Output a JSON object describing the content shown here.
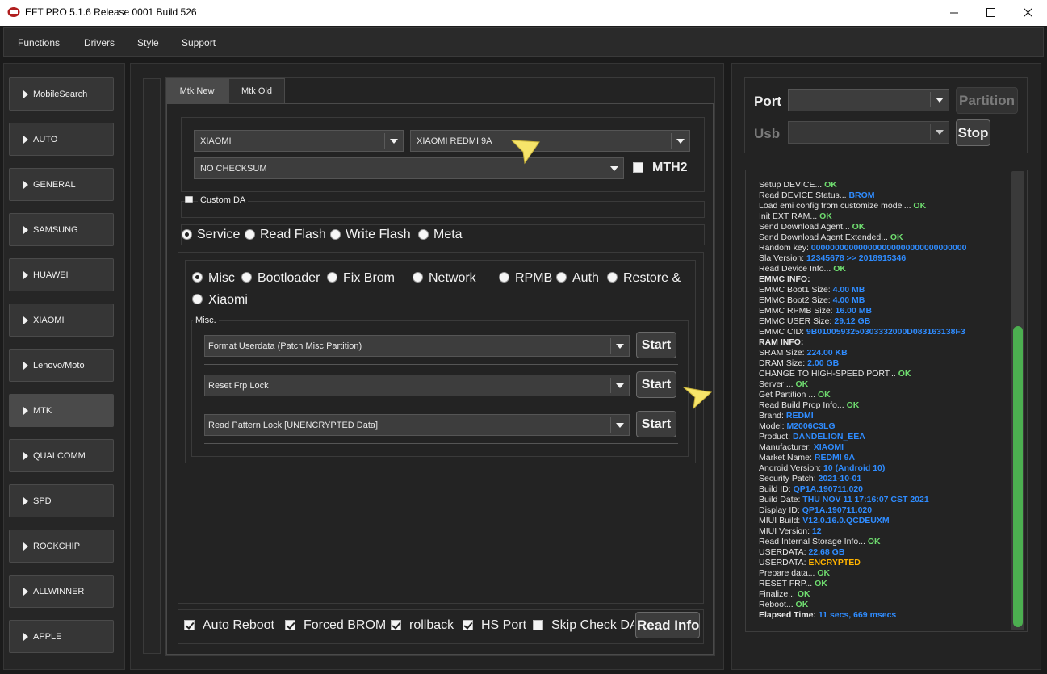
{
  "window": {
    "title": "EFT PRO 5.1.6 Release 0001 Build 526"
  },
  "menu": [
    "Functions",
    "Drivers",
    "Style",
    "Support"
  ],
  "sidebar": [
    {
      "label": "MobileSearch",
      "active": false
    },
    {
      "label": "AUTO",
      "active": false
    },
    {
      "label": "GENERAL",
      "active": false
    },
    {
      "label": "SAMSUNG",
      "active": false
    },
    {
      "label": "HUAWEI",
      "active": false
    },
    {
      "label": "XIAOMI",
      "active": false
    },
    {
      "label": "Lenovo/Moto",
      "active": false
    },
    {
      "label": "MTK",
      "active": true
    },
    {
      "label": "QUALCOMM",
      "active": false
    },
    {
      "label": "SPD",
      "active": false
    },
    {
      "label": "ROCKCHIP",
      "active": false
    },
    {
      "label": "ALLWINNER",
      "active": false
    },
    {
      "label": "APPLE",
      "active": false
    }
  ],
  "tabs": {
    "active": "Mtk New",
    "inactive": "Mtk Old"
  },
  "device": {
    "brand": "XIAOMI",
    "model": "XIAOMI REDMI 9A",
    "checksum": "NO CHECKSUM",
    "mth2_label": "MTH2",
    "custom_da_label": "Custom DA"
  },
  "modes": [
    {
      "label": "Service",
      "checked": true
    },
    {
      "label": "Read Flash",
      "checked": false
    },
    {
      "label": "Write Flash",
      "checked": false
    },
    {
      "label": "Meta",
      "checked": false
    }
  ],
  "subtabs": [
    {
      "label": "Misc",
      "checked": true
    },
    {
      "label": "Bootloader",
      "checked": false
    },
    {
      "label": "Fix Brom",
      "checked": false
    },
    {
      "label": "Network",
      "checked": false
    },
    {
      "label": "RPMB",
      "checked": false
    },
    {
      "label": "Auth",
      "checked": false
    },
    {
      "label": "Restore &",
      "checked": false
    },
    {
      "label": "Xiaomi",
      "checked": false
    }
  ],
  "misc": {
    "group_label": "Misc.",
    "start_label": "Start",
    "operations": [
      "Format Userdata (Patch Misc Partition)",
      "Reset Frp Lock",
      "Read Pattern Lock [UNENCRYPTED Data]"
    ]
  },
  "options": [
    {
      "label": "Auto Reboot",
      "checked": true
    },
    {
      "label": "Forced BROM",
      "checked": true
    },
    {
      "label": "rollback",
      "checked": true
    },
    {
      "label": "HS Port",
      "checked": true
    },
    {
      "label": "Skip Check DA",
      "checked": false
    }
  ],
  "read_info_label": "Read Info",
  "port": {
    "port_label": "Port",
    "usb_label": "Usb",
    "partition_label": "Partition",
    "stop_label": "Stop"
  },
  "colors": {
    "ok": "#6fdc6f",
    "value": "#2f8cff",
    "warn": "#ffb300"
  },
  "log": [
    {
      "text": "Setup DEVICE... ",
      "value": "OK",
      "color": "ok"
    },
    {
      "text": "Read DEVICE Status... ",
      "value": "BROM",
      "color": "value"
    },
    {
      "text": "Load emi config from customize model... ",
      "value": "OK",
      "color": "ok"
    },
    {
      "text": "Init EXT RAM... ",
      "value": "OK",
      "color": "ok"
    },
    {
      "text": "Send Download Agent... ",
      "value": "OK",
      "color": "ok"
    },
    {
      "text": "Send Download Agent Extended... ",
      "value": "OK",
      "color": "ok"
    },
    {
      "text": "Random key:  ",
      "value": "000000000000000000000000000000000",
      "color": "value"
    },
    {
      "text": "Sla Version:  ",
      "value": "12345678  >> 2018915346",
      "color": "value"
    },
    {
      "text": "Read Device Info... ",
      "value": "OK",
      "color": "ok"
    },
    {
      "text": " EMMC INFO:",
      "value": "",
      "color": "ok",
      "bold": true
    },
    {
      "text": "EMMC Boot1 Size: ",
      "value": "4.00 MB",
      "color": "value"
    },
    {
      "text": "EMMC Boot2 Size: ",
      "value": "4.00 MB",
      "color": "value"
    },
    {
      "text": "EMMC RPMB Size: ",
      "value": "16.00 MB",
      "color": "value"
    },
    {
      "text": "EMMC USER Size: ",
      "value": "29.12 GB",
      "color": "value"
    },
    {
      "text": "EMMC CID: ",
      "value": "9B0100593250303332000D083163138F3",
      "color": "value"
    },
    {
      "text": " RAM INFO:",
      "value": "",
      "color": "ok",
      "bold": true
    },
    {
      "text": "SRAM Size: ",
      "value": "224.00 KB",
      "color": "value"
    },
    {
      "text": "DRAM Size: ",
      "value": "2.00 GB",
      "color": "value"
    },
    {
      "text": "CHANGE TO HIGH-SPEED PORT... ",
      "value": "OK",
      "color": "ok"
    },
    {
      "text": "Server ... ",
      "value": "OK",
      "color": "ok"
    },
    {
      "text": "Get Partition ... ",
      "value": "OK",
      "color": "ok"
    },
    {
      "text": "Read Build Prop Info... ",
      "value": "OK",
      "color": "ok"
    },
    {
      "text": " Brand: ",
      "value": "REDMI",
      "color": "value"
    },
    {
      "text": " Model: ",
      "value": "M2006C3LG",
      "color": "value"
    },
    {
      "text": " Product: ",
      "value": "DANDELION_EEA",
      "color": "value"
    },
    {
      "text": " Manufacturer: ",
      "value": "XIAOMI",
      "color": "value"
    },
    {
      "text": " Market Name: ",
      "value": "REDMI 9A",
      "color": "value"
    },
    {
      "text": " Android Version: ",
      "value": "10 (Android 10)",
      "color": "value"
    },
    {
      "text": " Security Patch: ",
      "value": "2021-10-01",
      "color": "value"
    },
    {
      "text": " Build ID: ",
      "value": "QP1A.190711.020",
      "color": "value"
    },
    {
      "text": " Build Date: ",
      "value": "THU NOV 11 17:16:07 CST 2021",
      "color": "value"
    },
    {
      "text": " Display ID: ",
      "value": "QP1A.190711.020",
      "color": "value"
    },
    {
      "text": " MIUI Build: ",
      "value": "V12.0.16.0.QCDEUXM",
      "color": "value"
    },
    {
      "text": " MIUI Version: ",
      "value": "12",
      "color": "value"
    },
    {
      "text": "Read Internal Storage Info... ",
      "value": "OK",
      "color": "ok"
    },
    {
      "text": "USERDATA: ",
      "value": "22.68 GB",
      "color": "value"
    },
    {
      "text": "USERDATA: ",
      "value": "ENCRYPTED",
      "color": "warn"
    },
    {
      "text": "Prepare data... ",
      "value": "OK",
      "color": "ok"
    },
    {
      "text": "RESET FRP... ",
      "value": "OK",
      "color": "ok"
    },
    {
      "text": "Finalize... ",
      "value": "OK",
      "color": "ok"
    },
    {
      "text": "Reboot... ",
      "value": "OK",
      "color": "ok"
    },
    {
      "text": " Elapsed Time: ",
      "value": "11 secs, 669 msecs",
      "color": "value",
      "bold": true
    }
  ]
}
